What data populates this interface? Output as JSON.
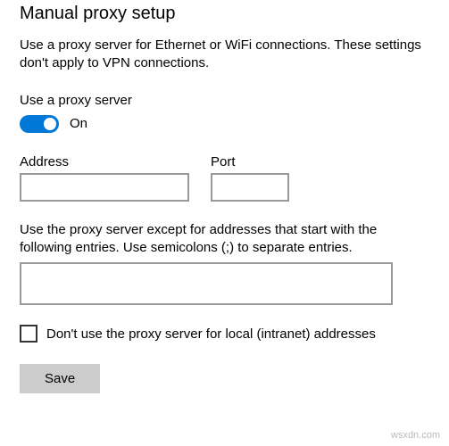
{
  "heading": "Manual proxy setup",
  "description": "Use a proxy server for Ethernet or WiFi connections. These settings don't apply to VPN connections.",
  "toggle": {
    "label": "Use a proxy server",
    "state_text": "On",
    "on": true
  },
  "fields": {
    "address": {
      "label": "Address",
      "value": ""
    },
    "port": {
      "label": "Port",
      "value": ""
    }
  },
  "exceptions": {
    "description": "Use the proxy server except for addresses that start with the following entries. Use semicolons (;) to separate entries.",
    "value": ""
  },
  "local_bypass": {
    "label": "Don't use the proxy server for local (intranet) addresses",
    "checked": false
  },
  "save_label": "Save",
  "watermark": "wsxdn.com"
}
